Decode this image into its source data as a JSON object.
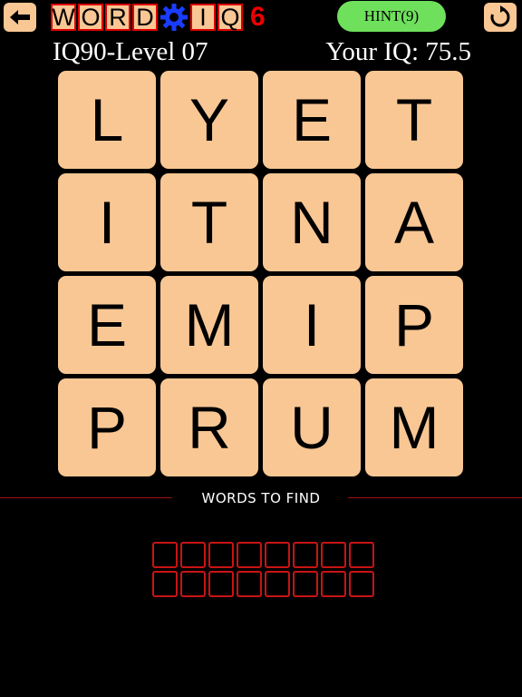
{
  "header": {
    "logo_letters_a": [
      "W",
      "O",
      "R",
      "D"
    ],
    "logo_letters_b": [
      "I",
      "Q"
    ],
    "logo_number": "6",
    "hint_label": "HINT(9)",
    "accent_color": "#f9c794",
    "logo_border_color": "#dd0000",
    "hint_color": "#6ee05c"
  },
  "level": {
    "title": "IQ90-Level 07",
    "iq_text": "Your IQ: 75.5"
  },
  "board": {
    "tiles": [
      "L",
      "Y",
      "E",
      "T",
      "I",
      "T",
      "N",
      "A",
      "E",
      "M",
      "I",
      "P",
      "P",
      "R",
      "U",
      "M"
    ]
  },
  "words_to_find": {
    "label": "WORDS TO FIND",
    "rows": [
      {
        "slots": 8
      },
      {
        "slots": 8
      }
    ]
  },
  "icons": {
    "back": "arrow-left-icon",
    "refresh": "refresh-icon",
    "gear": "gear-icon"
  }
}
